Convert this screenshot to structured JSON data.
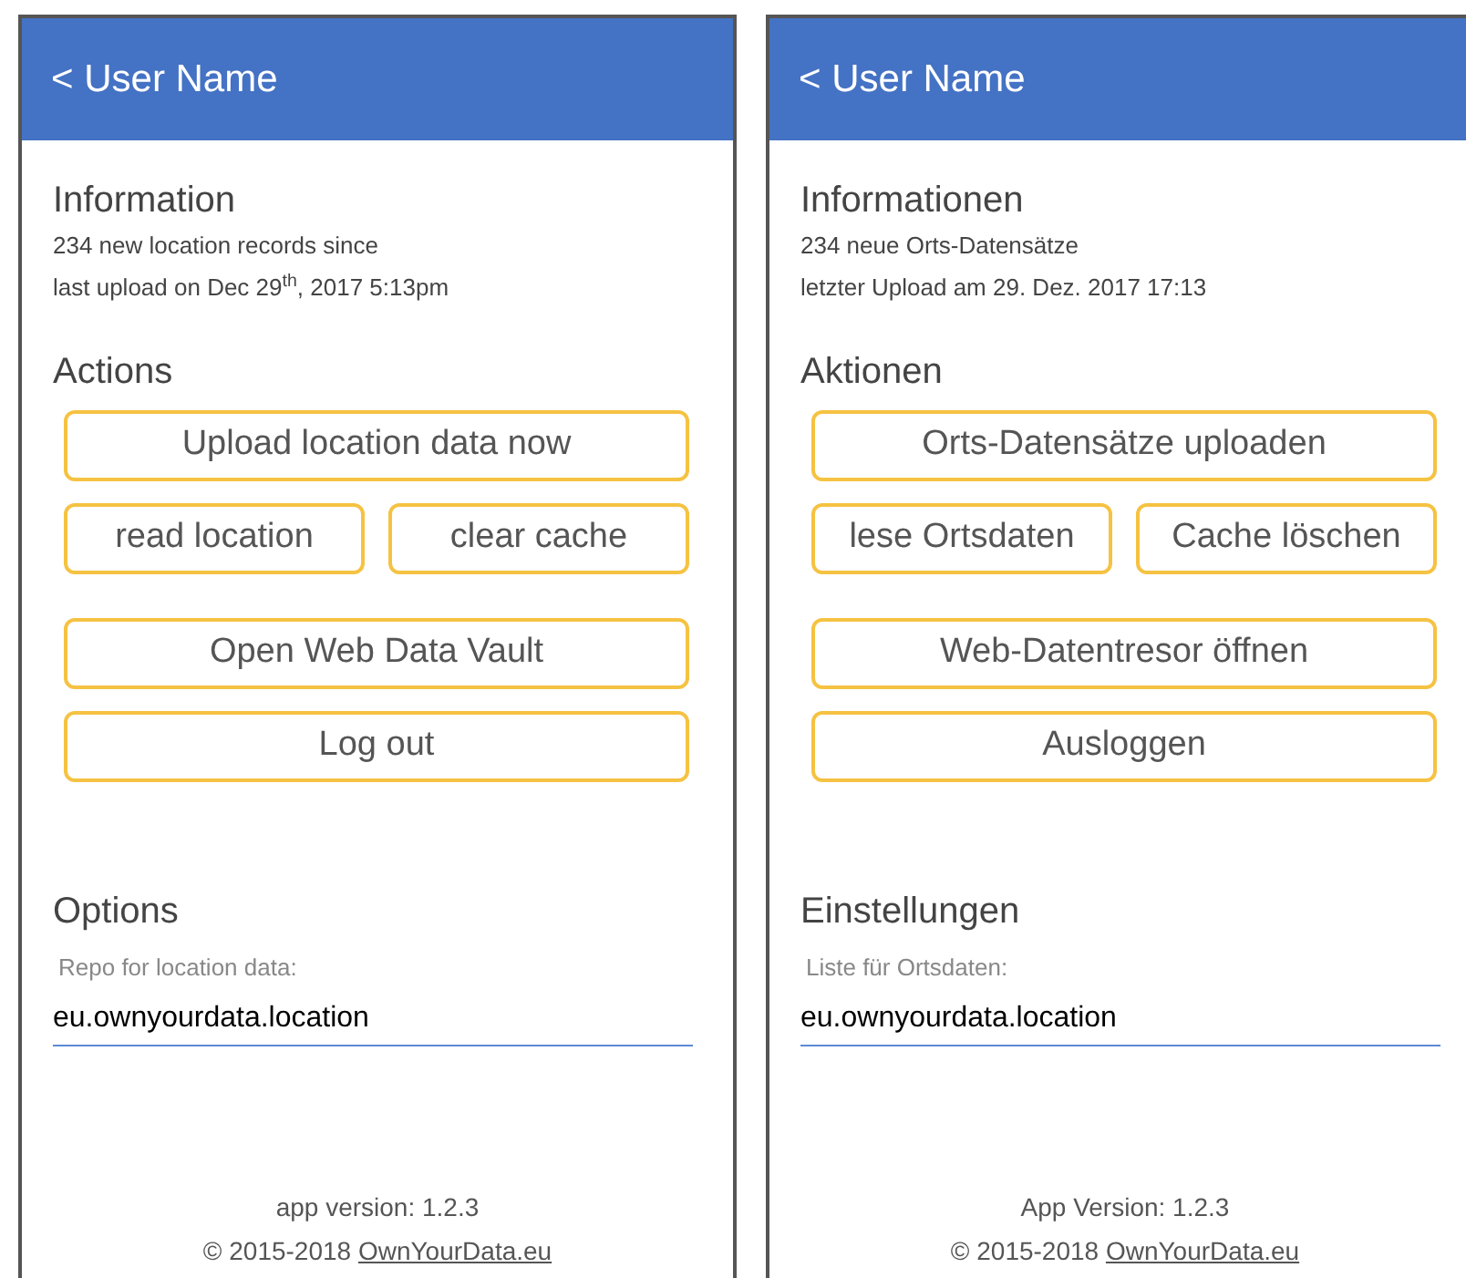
{
  "panels": [
    {
      "header": {
        "title": "< User Name"
      },
      "information": {
        "heading": "Information",
        "lines": [
          "234 new location records since",
          "last upload on Dec 29$^{th}$, 2017 5:13pm"
        ]
      },
      "actions": {
        "heading": "Actions",
        "button_rows": [
          [
            "Upload location data now"
          ],
          [
            "read location",
            "clear cache"
          ],
          [
            "Open Web Data Vault"
          ],
          [
            "Log out"
          ]
        ]
      },
      "options": {
        "heading": "Options",
        "field": {
          "label": "Repo for location data:",
          "value": "eu.ownyourdata.location"
        }
      },
      "footer": {
        "version": "app version: 1.2.3",
        "copyright": "© 2015-2018",
        "link": "OwnYourData.eu"
      }
    },
    {
      "header": {
        "title": "< User Name"
      },
      "information": {
        "heading": "Informationen",
        "lines": [
          "234 neue Orts-Datensätze",
          "letzter Upload am 29. Dez. 2017 17:13"
        ]
      },
      "actions": {
        "heading": "Aktionen",
        "button_rows": [
          [
            "Orts-Datensätze uploaden"
          ],
          [
            "lese Ortsdaten",
            "Cache löschen"
          ],
          [
            "Web-Datentresor öffnen"
          ],
          [
            "Ausloggen"
          ]
        ]
      },
      "options": {
        "heading": "Einstellungen",
        "field": {
          "label": "Liste für Ortsdaten:",
          "value": "eu.ownyourdata.location"
        }
      },
      "footer": {
        "version": "App Version: 1.2.3",
        "copyright": "© 2015-2018",
        "link": "OwnYourData.eu"
      }
    }
  ]
}
